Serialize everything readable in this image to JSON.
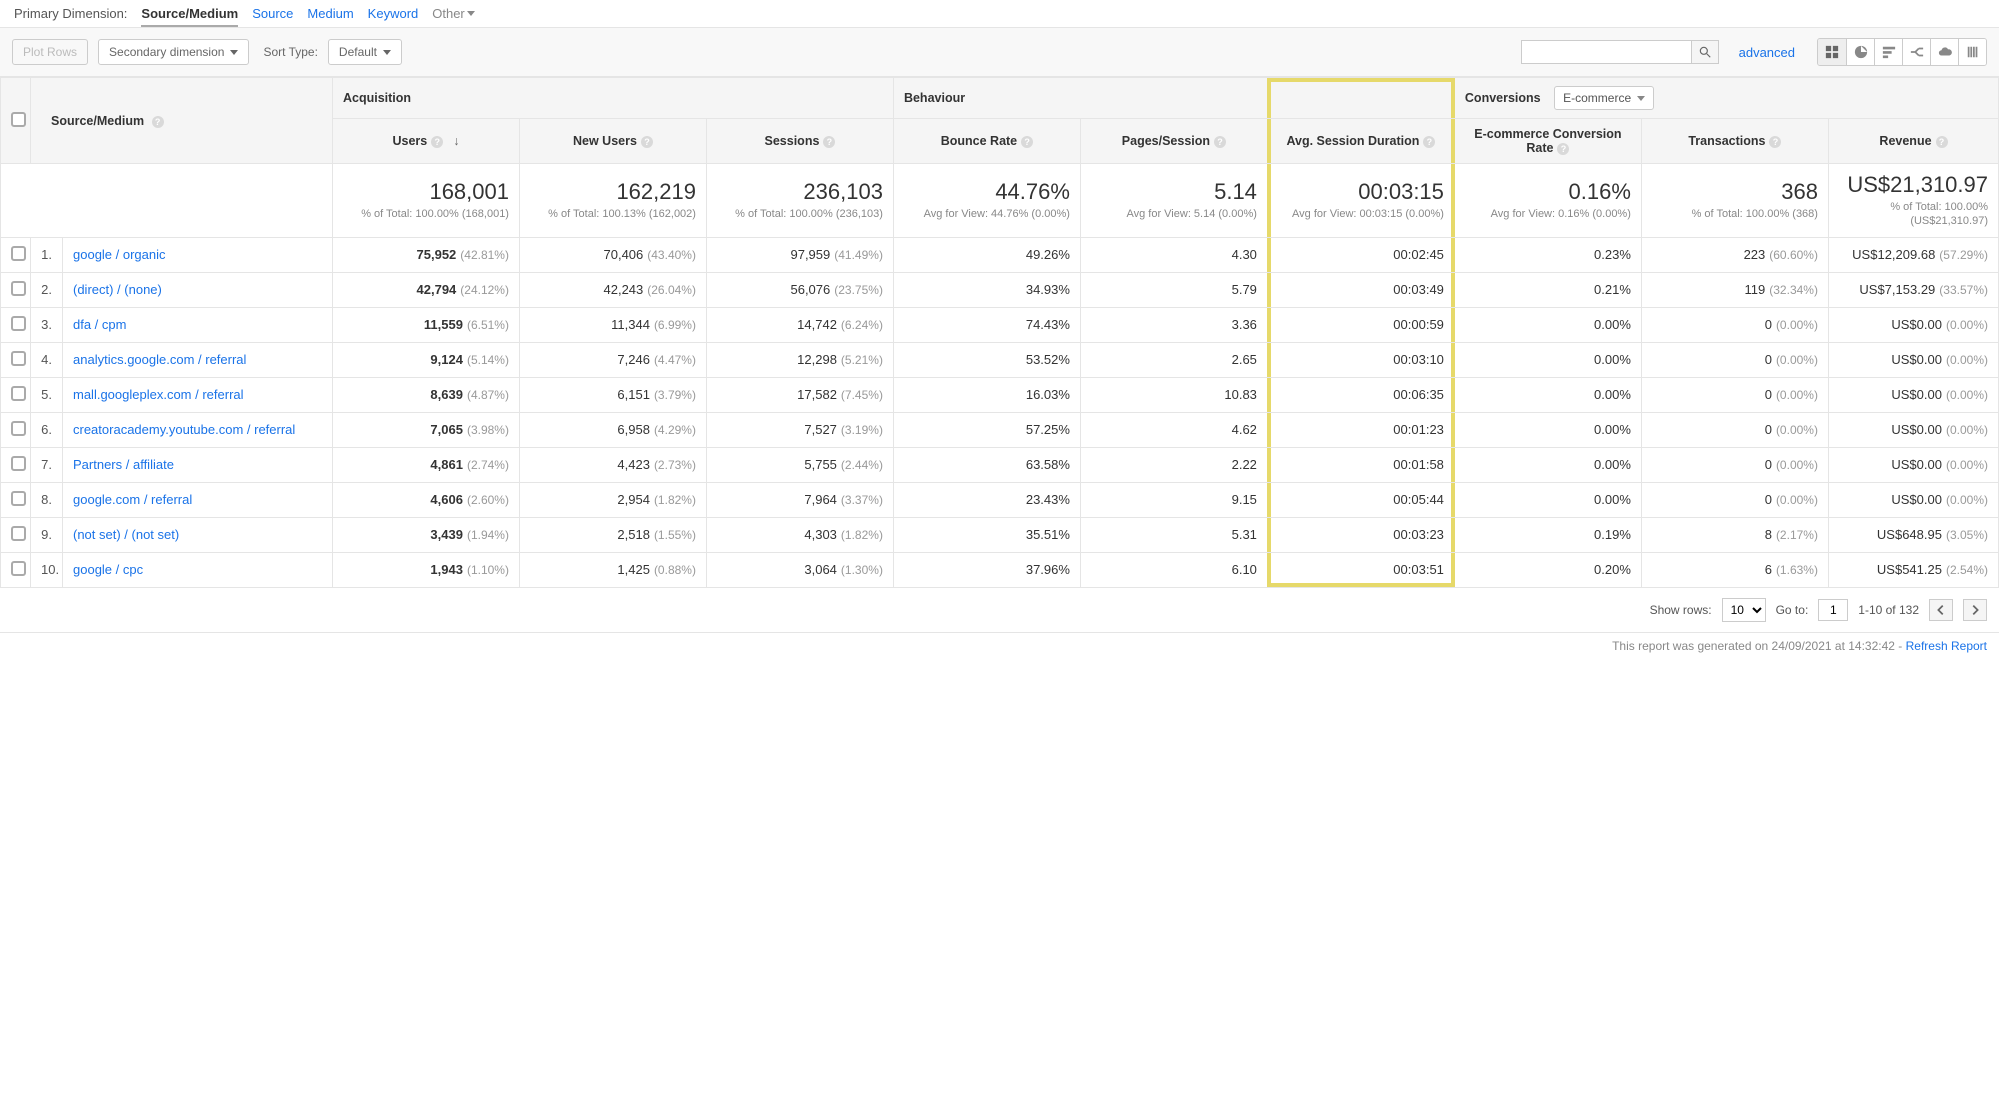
{
  "primary_dimension": {
    "label": "Primary Dimension:",
    "current": "Source/Medium",
    "options": [
      "Source",
      "Medium",
      "Keyword"
    ],
    "other_label": "Other"
  },
  "toolbar": {
    "plot_rows_label": "Plot Rows",
    "secondary_dim_label": "Secondary dimension",
    "sort_type_label": "Sort Type:",
    "sort_default_label": "Default",
    "search_placeholder": "",
    "advanced_label": "advanced"
  },
  "column_groups": {
    "acquisition": "Acquisition",
    "behaviour": "Behaviour",
    "conversions": "Conversions",
    "conversions_filter": "E-commerce"
  },
  "columns": {
    "source_medium": "Source/Medium",
    "users": "Users",
    "new_users": "New Users",
    "sessions": "Sessions",
    "bounce_rate": "Bounce Rate",
    "pages_session": "Pages/Session",
    "avg_session": "Avg. Session Duration",
    "ecom_conv": "E-commerce Conversion Rate",
    "transactions": "Transactions",
    "revenue": "Revenue"
  },
  "totals": {
    "users": {
      "main": "168,001",
      "sub": "% of Total: 100.00% (168,001)"
    },
    "new_users": {
      "main": "162,219",
      "sub": "% of Total: 100.13% (162,002)"
    },
    "sessions": {
      "main": "236,103",
      "sub": "% of Total: 100.00% (236,103)"
    },
    "bounce_rate": {
      "main": "44.76%",
      "sub": "Avg for View: 44.76% (0.00%)"
    },
    "pages_session": {
      "main": "5.14",
      "sub": "Avg for View: 5.14 (0.00%)"
    },
    "avg_session": {
      "main": "00:03:15",
      "sub": "Avg for View: 00:03:15 (0.00%)"
    },
    "ecom_conv": {
      "main": "0.16%",
      "sub": "Avg for View: 0.16% (0.00%)"
    },
    "transactions": {
      "main": "368",
      "sub": "% of Total: 100.00% (368)"
    },
    "revenue": {
      "main": "US$21,310.97",
      "sub": "% of Total: 100.00% (US$21,310.97)"
    }
  },
  "rows": [
    {
      "idx": "1.",
      "name": "google / organic",
      "users": "75,952",
      "users_pct": "(42.81%)",
      "new_users": "70,406",
      "new_users_pct": "(43.40%)",
      "sessions": "97,959",
      "sessions_pct": "(41.49%)",
      "bounce": "49.26%",
      "pps": "4.30",
      "dur": "00:02:45",
      "conv": "0.23%",
      "tx": "223",
      "tx_pct": "(60.60%)",
      "rev": "US$12,209.68",
      "rev_pct": "(57.29%)"
    },
    {
      "idx": "2.",
      "name": "(direct) / (none)",
      "users": "42,794",
      "users_pct": "(24.12%)",
      "new_users": "42,243",
      "new_users_pct": "(26.04%)",
      "sessions": "56,076",
      "sessions_pct": "(23.75%)",
      "bounce": "34.93%",
      "pps": "5.79",
      "dur": "00:03:49",
      "conv": "0.21%",
      "tx": "119",
      "tx_pct": "(32.34%)",
      "rev": "US$7,153.29",
      "rev_pct": "(33.57%)"
    },
    {
      "idx": "3.",
      "name": "dfa / cpm",
      "users": "11,559",
      "users_pct": "(6.51%)",
      "new_users": "11,344",
      "new_users_pct": "(6.99%)",
      "sessions": "14,742",
      "sessions_pct": "(6.24%)",
      "bounce": "74.43%",
      "pps": "3.36",
      "dur": "00:00:59",
      "conv": "0.00%",
      "tx": "0",
      "tx_pct": "(0.00%)",
      "rev": "US$0.00",
      "rev_pct": "(0.00%)"
    },
    {
      "idx": "4.",
      "name": "analytics.google.com / referral",
      "users": "9,124",
      "users_pct": "(5.14%)",
      "new_users": "7,246",
      "new_users_pct": "(4.47%)",
      "sessions": "12,298",
      "sessions_pct": "(5.21%)",
      "bounce": "53.52%",
      "pps": "2.65",
      "dur": "00:03:10",
      "conv": "0.00%",
      "tx": "0",
      "tx_pct": "(0.00%)",
      "rev": "US$0.00",
      "rev_pct": "(0.00%)"
    },
    {
      "idx": "5.",
      "name": "mall.googleplex.com / referral",
      "users": "8,639",
      "users_pct": "(4.87%)",
      "new_users": "6,151",
      "new_users_pct": "(3.79%)",
      "sessions": "17,582",
      "sessions_pct": "(7.45%)",
      "bounce": "16.03%",
      "pps": "10.83",
      "dur": "00:06:35",
      "conv": "0.00%",
      "tx": "0",
      "tx_pct": "(0.00%)",
      "rev": "US$0.00",
      "rev_pct": "(0.00%)"
    },
    {
      "idx": "6.",
      "name": "creatoracademy.youtube.com / referral",
      "users": "7,065",
      "users_pct": "(3.98%)",
      "new_users": "6,958",
      "new_users_pct": "(4.29%)",
      "sessions": "7,527",
      "sessions_pct": "(3.19%)",
      "bounce": "57.25%",
      "pps": "4.62",
      "dur": "00:01:23",
      "conv": "0.00%",
      "tx": "0",
      "tx_pct": "(0.00%)",
      "rev": "US$0.00",
      "rev_pct": "(0.00%)"
    },
    {
      "idx": "7.",
      "name": "Partners / affiliate",
      "users": "4,861",
      "users_pct": "(2.74%)",
      "new_users": "4,423",
      "new_users_pct": "(2.73%)",
      "sessions": "5,755",
      "sessions_pct": "(2.44%)",
      "bounce": "63.58%",
      "pps": "2.22",
      "dur": "00:01:58",
      "conv": "0.00%",
      "tx": "0",
      "tx_pct": "(0.00%)",
      "rev": "US$0.00",
      "rev_pct": "(0.00%)"
    },
    {
      "idx": "8.",
      "name": "google.com / referral",
      "users": "4,606",
      "users_pct": "(2.60%)",
      "new_users": "2,954",
      "new_users_pct": "(1.82%)",
      "sessions": "7,964",
      "sessions_pct": "(3.37%)",
      "bounce": "23.43%",
      "pps": "9.15",
      "dur": "00:05:44",
      "conv": "0.00%",
      "tx": "0",
      "tx_pct": "(0.00%)",
      "rev": "US$0.00",
      "rev_pct": "(0.00%)"
    },
    {
      "idx": "9.",
      "name": "(not set) / (not set)",
      "users": "3,439",
      "users_pct": "(1.94%)",
      "new_users": "2,518",
      "new_users_pct": "(1.55%)",
      "sessions": "4,303",
      "sessions_pct": "(1.82%)",
      "bounce": "35.51%",
      "pps": "5.31",
      "dur": "00:03:23",
      "conv": "0.19%",
      "tx": "8",
      "tx_pct": "(2.17%)",
      "rev": "US$648.95",
      "rev_pct": "(3.05%)"
    },
    {
      "idx": "10.",
      "name": "google / cpc",
      "users": "1,943",
      "users_pct": "(1.10%)",
      "new_users": "1,425",
      "new_users_pct": "(0.88%)",
      "sessions": "3,064",
      "sessions_pct": "(1.30%)",
      "bounce": "37.96%",
      "pps": "6.10",
      "dur": "00:03:51",
      "conv": "0.20%",
      "tx": "6",
      "tx_pct": "(1.63%)",
      "rev": "US$541.25",
      "rev_pct": "(2.54%)"
    }
  ],
  "pager": {
    "show_rows_label": "Show rows:",
    "show_rows_value": "10",
    "goto_label": "Go to:",
    "goto_value": "1",
    "range_label": "1-10 of 132"
  },
  "meta": {
    "text": "This report was generated on 24/09/2021 at 14:32:42 - ",
    "refresh": "Refresh Report"
  }
}
